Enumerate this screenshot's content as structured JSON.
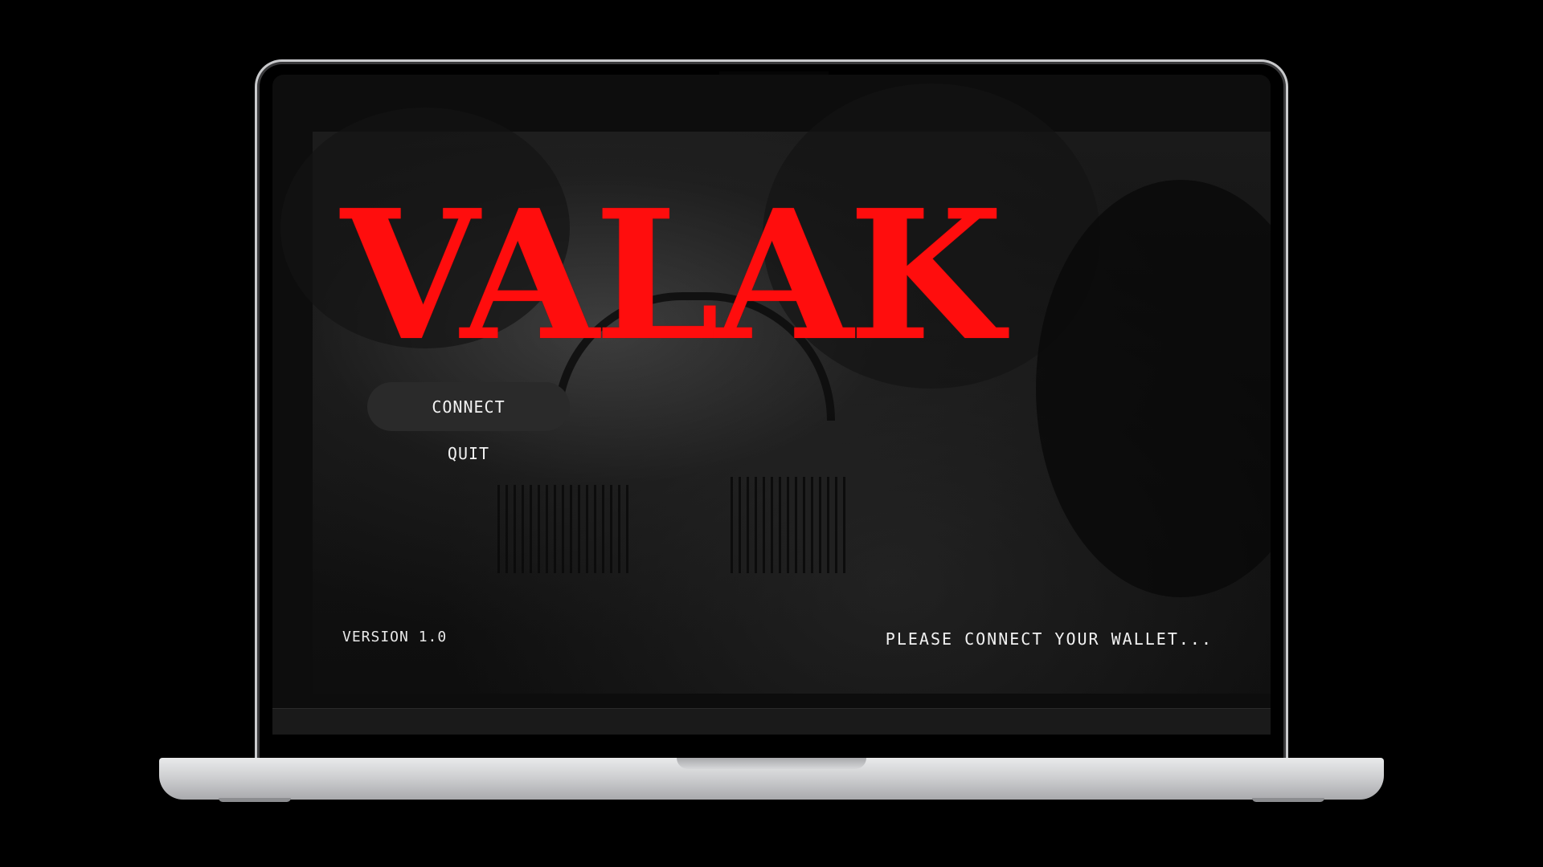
{
  "game": {
    "title": "VALAK",
    "menu": {
      "connect_label": "CONNECT",
      "quit_label": "QUIT"
    },
    "version_label": "VERSION 1.0",
    "status_message": "PLEASE CONNECT YOUR WALLET..."
  },
  "colors": {
    "title_red": "#ff0d0d",
    "active_button_bg": "#2a2a2a",
    "text": "#f2f2f2",
    "background": "#000000"
  }
}
